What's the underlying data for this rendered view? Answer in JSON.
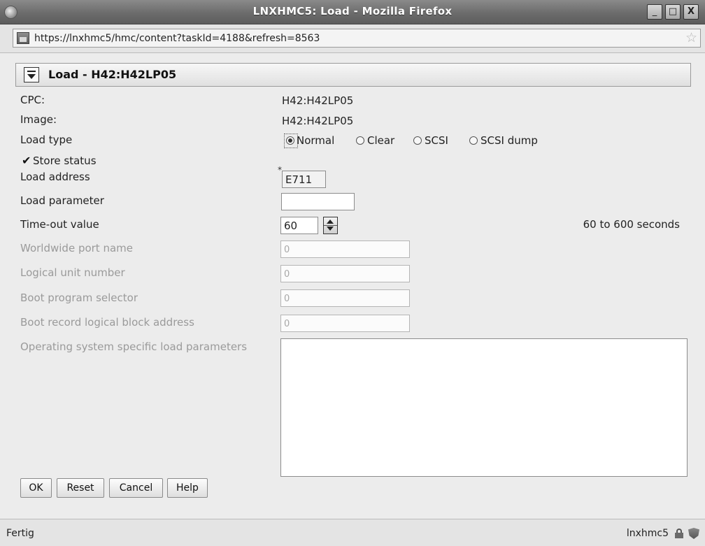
{
  "window": {
    "title": "LNXHMC5: Load - Mozilla Firefox",
    "minimize": "_",
    "maximize": "□",
    "close": "X"
  },
  "browser": {
    "url": "https://lnxhmc5/hmc/content?taskId=4188&refresh=8563",
    "status": "Fertig",
    "host": "lnxhmc5"
  },
  "panel": {
    "title": "Load - H42:H42LP05"
  },
  "form": {
    "cpc_label": "CPC:",
    "cpc_value": "H42:H42LP05",
    "image_label": "Image:",
    "image_value": "H42:H42LP05",
    "load_type_label": "Load type",
    "load_type_options": [
      "Normal",
      "Clear",
      "SCSI",
      "SCSI dump"
    ],
    "load_type_selected": "Normal",
    "store_status_label": "Store status",
    "store_status_checked": true,
    "required_marker": "*",
    "load_address_label": "Load address",
    "load_address_value": "E711",
    "load_parameter_label": "Load parameter",
    "load_parameter_value": "",
    "timeout_label": "Time-out value",
    "timeout_value": "60",
    "timeout_hint": "60 to 600 seconds",
    "wwpn_label": "Worldwide port name",
    "wwpn_value": "0",
    "lun_label": "Logical unit number",
    "lun_value": "0",
    "boot_program_label": "Boot program selector",
    "boot_program_value": "0",
    "boot_record_label": "Boot record logical block address",
    "boot_record_value": "0",
    "os_params_label": "Operating system specific load parameters",
    "os_params_value": ""
  },
  "buttons": {
    "ok": "OK",
    "reset": "Reset",
    "cancel": "Cancel",
    "help": "Help"
  }
}
